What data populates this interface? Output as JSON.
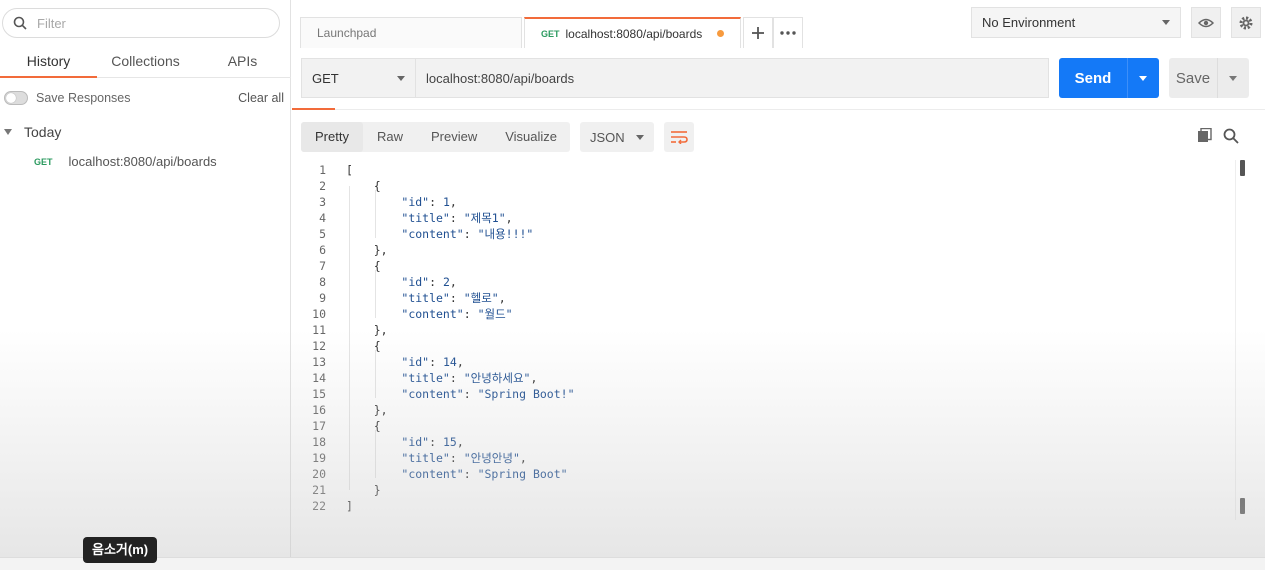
{
  "sidebar": {
    "filter_placeholder": "Filter",
    "tabs": [
      {
        "label": "History",
        "active": true
      },
      {
        "label": "Collections",
        "active": false
      },
      {
        "label": "APIs",
        "active": false
      }
    ],
    "save_responses_label": "Save Responses",
    "clear_all_label": "Clear all",
    "group_label": "Today",
    "history_items": [
      {
        "method": "GET",
        "url": "localhost:8080/api/boards"
      }
    ]
  },
  "tabs": {
    "launchpad_label": "Launchpad",
    "active_method": "GET",
    "active_label": "localhost:8080/api/boards",
    "add_icon": "plus-icon",
    "more_icon": "ellipsis-icon"
  },
  "environment": {
    "selected": "No Environment",
    "eye_icon": "eye-icon",
    "settings_icon": "gear-icon"
  },
  "request": {
    "method": "GET",
    "url": "localhost:8080/api/boards",
    "send_label": "Send",
    "save_label": "Save"
  },
  "response": {
    "view_modes": [
      {
        "label": "Pretty",
        "active": true
      },
      {
        "label": "Raw",
        "active": false
      },
      {
        "label": "Preview",
        "active": false
      },
      {
        "label": "Visualize",
        "active": false
      }
    ],
    "format": "JSON",
    "lines": [
      {
        "n": "1",
        "text": "["
      },
      {
        "n": "2",
        "text": "    {"
      },
      {
        "n": "3",
        "text": "        \"id\": 1,"
      },
      {
        "n": "4",
        "text": "        \"title\": \"제목1\","
      },
      {
        "n": "5",
        "text": "        \"content\": \"내용!!!\""
      },
      {
        "n": "6",
        "text": "    },"
      },
      {
        "n": "7",
        "text": "    {"
      },
      {
        "n": "8",
        "text": "        \"id\": 2,"
      },
      {
        "n": "9",
        "text": "        \"title\": \"헬로\","
      },
      {
        "n": "10",
        "text": "        \"content\": \"월드\""
      },
      {
        "n": "11",
        "text": "    },"
      },
      {
        "n": "12",
        "text": "    {"
      },
      {
        "n": "13",
        "text": "        \"id\": 14,"
      },
      {
        "n": "14",
        "text": "        \"title\": \"안녕하세요\","
      },
      {
        "n": "15",
        "text": "        \"content\": \"Spring Boot!\""
      },
      {
        "n": "16",
        "text": "    },"
      },
      {
        "n": "17",
        "text": "    {"
      },
      {
        "n": "18",
        "text": "        \"id\": 15,"
      },
      {
        "n": "19",
        "text": "        \"title\": \"안녕안녕\","
      },
      {
        "n": "20",
        "text": "        \"content\": \"Spring Boot\""
      },
      {
        "n": "21",
        "text": "    }"
      },
      {
        "n": "22",
        "text": "]"
      }
    ]
  },
  "tooltip": "음소거(m)"
}
